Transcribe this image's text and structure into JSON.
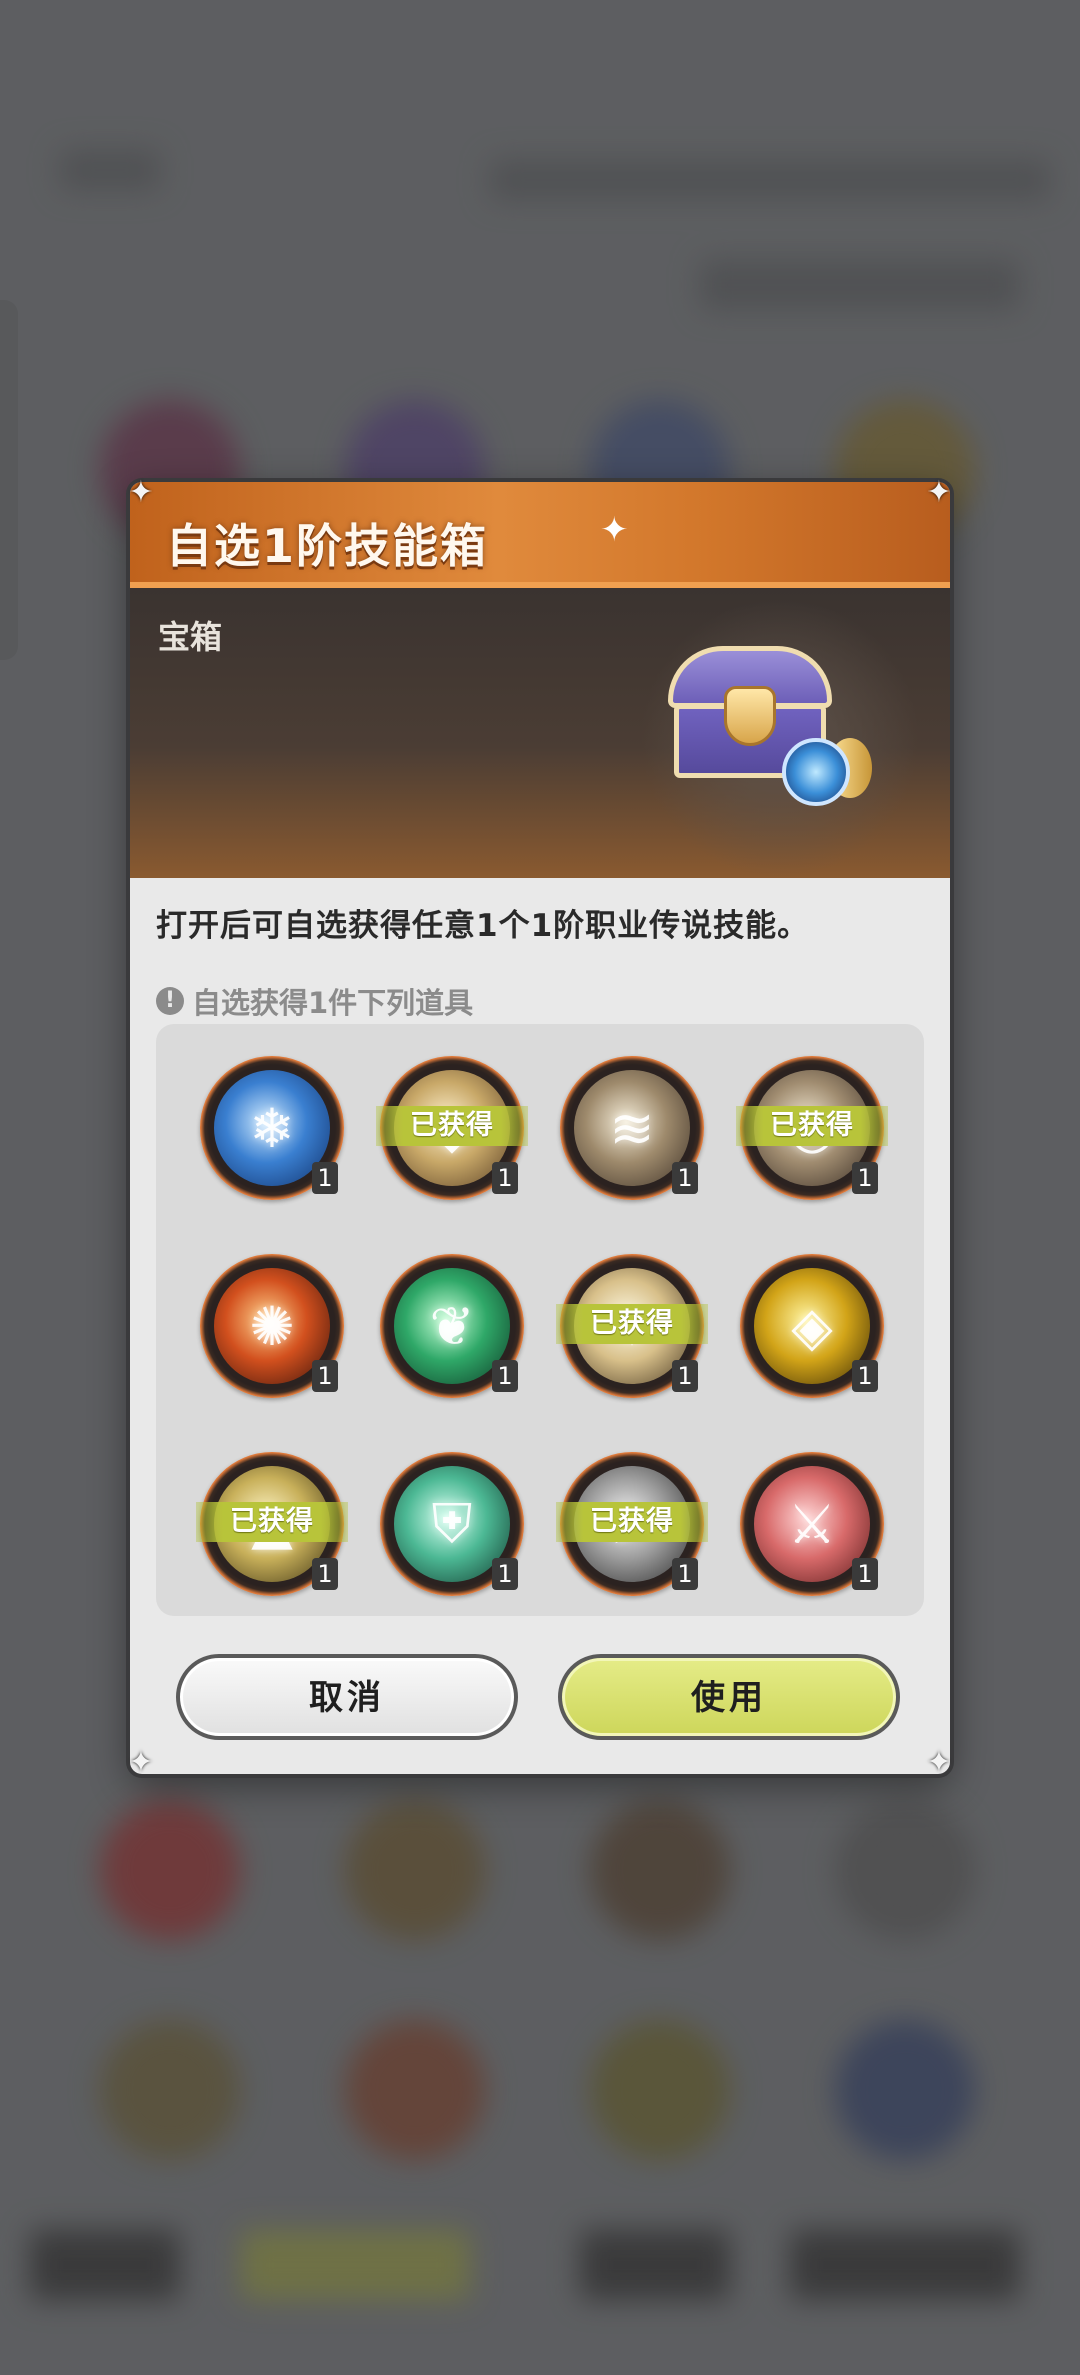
{
  "dialog": {
    "title": "自选1阶技能箱",
    "category": "宝箱",
    "description": "打开后可自选获得任意1个1阶职业传说技能。",
    "hint": "自选获得1件下列道具",
    "cancel_label": "取消",
    "use_label": "使用",
    "owned_label": "已获得"
  },
  "items": [
    {
      "name": "ice-skill-icon",
      "count": "1",
      "owned": false,
      "colors": [
        "#cfeaff",
        "#3a7fd0",
        "#10306a"
      ],
      "glyph": "❄"
    },
    {
      "name": "shield-slash-skill-icon",
      "count": "1",
      "owned": true,
      "colors": [
        "#fff2d0",
        "#c8a868",
        "#5a4026"
      ],
      "glyph": "◆"
    },
    {
      "name": "wind-slash-skill-icon",
      "count": "1",
      "owned": false,
      "colors": [
        "#f4ecd8",
        "#9e8a6c",
        "#3e3228"
      ],
      "glyph": "≋"
    },
    {
      "name": "whirl-skill-icon",
      "count": "1",
      "owned": true,
      "colors": [
        "#f0e6d0",
        "#a08c70",
        "#3a2e26"
      ],
      "glyph": "◎"
    },
    {
      "name": "fire-swirl-skill-icon",
      "count": "1",
      "owned": false,
      "colors": [
        "#ffd08a",
        "#d2501e",
        "#3a120a"
      ],
      "glyph": "✺"
    },
    {
      "name": "nature-leaf-skill-icon",
      "count": "1",
      "owned": false,
      "colors": [
        "#c8ffd8",
        "#2fa868",
        "#0e3a26"
      ],
      "glyph": "❦"
    },
    {
      "name": "light-burst-skill-icon",
      "count": "1",
      "owned": true,
      "colors": [
        "#fffbe6",
        "#d8c08a",
        "#4a3a24"
      ],
      "glyph": "✹"
    },
    {
      "name": "golden-crystal-skill-icon",
      "count": "1",
      "owned": false,
      "colors": [
        "#fff4a0",
        "#d2a418",
        "#3a2a06"
      ],
      "glyph": "◈"
    },
    {
      "name": "holy-rise-skill-icon",
      "count": "1",
      "owned": true,
      "colors": [
        "#fff6c8",
        "#c8b05a",
        "#3e3414"
      ],
      "glyph": "▲"
    },
    {
      "name": "green-shield-skill-icon",
      "count": "1",
      "owned": false,
      "colors": [
        "#d6fff0",
        "#4cb894",
        "#123a2e"
      ],
      "glyph": "⛨"
    },
    {
      "name": "arrow-strike-skill-icon",
      "count": "1",
      "owned": true,
      "colors": [
        "#f2f2f2",
        "#9c9c9c",
        "#2c2c2c"
      ],
      "glyph": "➤"
    },
    {
      "name": "red-sword-skill-icon",
      "count": "1",
      "owned": false,
      "colors": [
        "#ffd6d6",
        "#d86a6a",
        "#5a1c1c"
      ],
      "glyph": "⚔"
    }
  ]
}
